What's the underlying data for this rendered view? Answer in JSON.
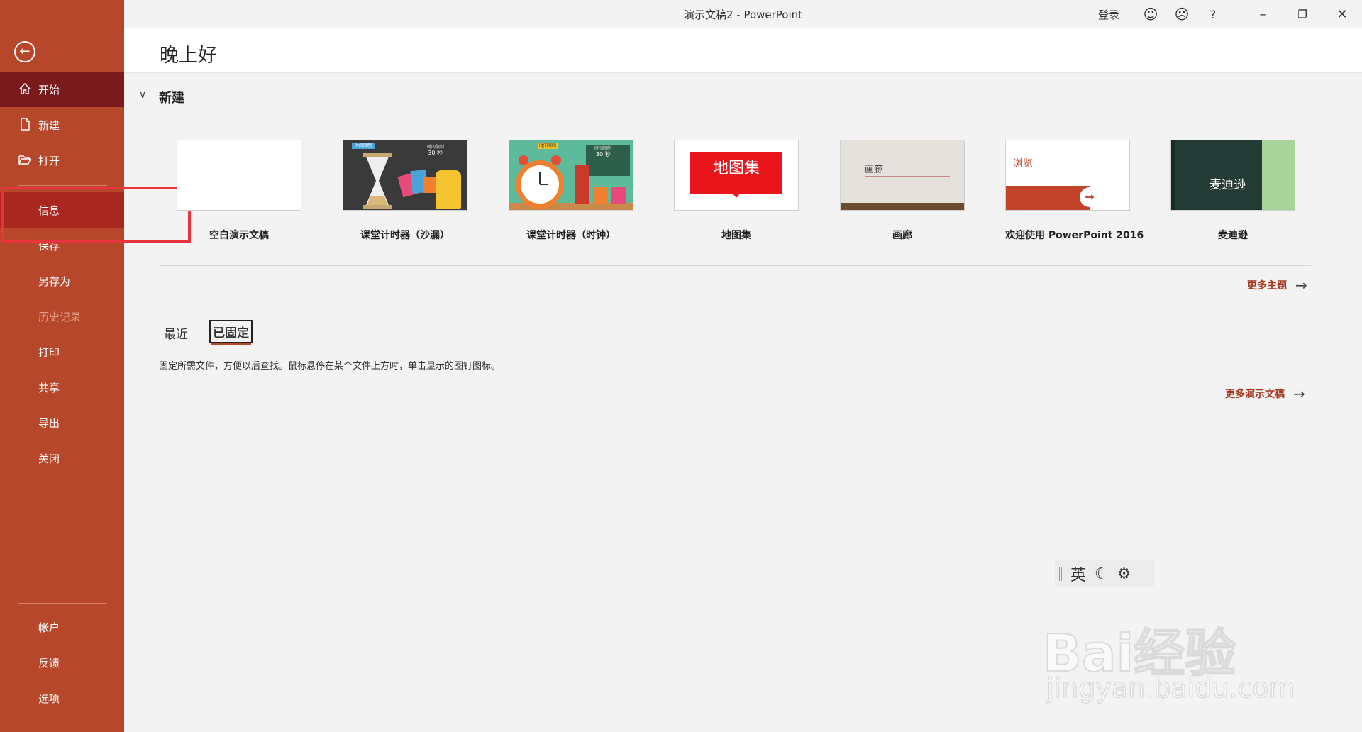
{
  "window": {
    "title": "演示文稿2  -  PowerPoint",
    "login": "登录"
  },
  "sidebar": {
    "items": [
      {
        "label": "开始",
        "icon": "home-icon"
      },
      {
        "label": "新建",
        "icon": "new-document-icon"
      },
      {
        "label": "打开",
        "icon": "open-folder-icon"
      },
      {
        "label": "信息"
      },
      {
        "label": "保存"
      },
      {
        "label": "另存为"
      },
      {
        "label": "历史记录"
      },
      {
        "label": "打印"
      },
      {
        "label": "共享"
      },
      {
        "label": "导出"
      },
      {
        "label": "关闭"
      }
    ],
    "bottom_items": [
      {
        "label": "帐户"
      },
      {
        "label": "反馈"
      },
      {
        "label": "选项"
      }
    ]
  },
  "header": {
    "greeting": "晚上好"
  },
  "new_section": {
    "title": "新建",
    "templates": [
      {
        "label": "空白演示文稿"
      },
      {
        "label": "课堂计时器（沙漏）",
        "thumb_text_a": "时间限制",
        "thumb_text_b": "30 秒"
      },
      {
        "label": "课堂计时器（时钟）",
        "thumb_text_a": "时间限制",
        "thumb_text_b": "30 秒"
      },
      {
        "label": "地图集",
        "thumb_text": "地图集"
      },
      {
        "label": "画廊",
        "thumb_text": "画廊"
      },
      {
        "label": "欢迎使用 PowerPoint 2016",
        "thumb_text": "浏览"
      },
      {
        "label": "麦迪逊",
        "thumb_text": "麦迪逊"
      }
    ],
    "more_themes": "更多主题"
  },
  "files": {
    "tabs": [
      "最近",
      "已固定"
    ],
    "selected_tab": "已固定",
    "pinned_hint": "固定所需文件，方便以后查找。鼠标悬停在某个文件上方时，单击显示的图钉图标。",
    "more_presentations": "更多演示文稿"
  },
  "ime": {
    "mode": "英"
  },
  "watermark": {
    "main": "Bai经验",
    "sub": "jingyan.baidu.com"
  },
  "colors": {
    "sidebar": "#b7472a",
    "active": "#7a1a1c",
    "link": "#a5371e",
    "highlight": "#e8343a"
  }
}
